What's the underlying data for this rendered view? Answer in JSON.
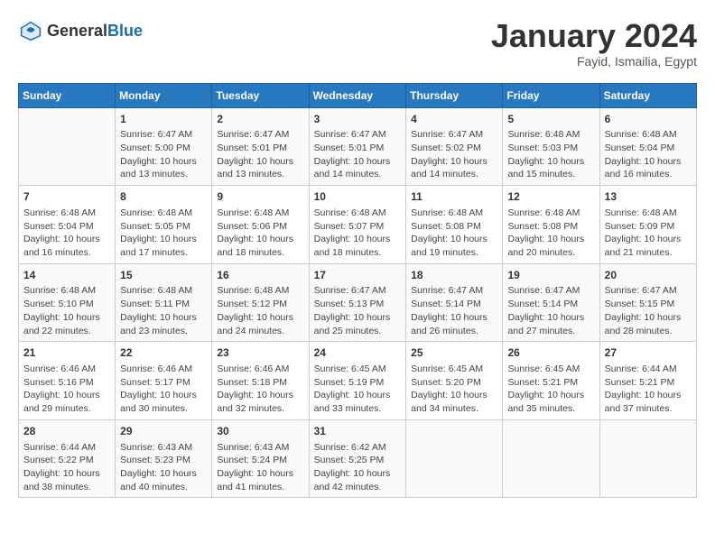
{
  "header": {
    "logo_general": "General",
    "logo_blue": "Blue",
    "month_title": "January 2024",
    "location": "Fayid, Ismailia, Egypt"
  },
  "columns": [
    "Sunday",
    "Monday",
    "Tuesday",
    "Wednesday",
    "Thursday",
    "Friday",
    "Saturday"
  ],
  "weeks": [
    [
      {
        "day": "",
        "content": ""
      },
      {
        "day": "1",
        "content": "Sunrise: 6:47 AM\nSunset: 5:00 PM\nDaylight: 10 hours\nand 13 minutes."
      },
      {
        "day": "2",
        "content": "Sunrise: 6:47 AM\nSunset: 5:01 PM\nDaylight: 10 hours\nand 13 minutes."
      },
      {
        "day": "3",
        "content": "Sunrise: 6:47 AM\nSunset: 5:01 PM\nDaylight: 10 hours\nand 14 minutes."
      },
      {
        "day": "4",
        "content": "Sunrise: 6:47 AM\nSunset: 5:02 PM\nDaylight: 10 hours\nand 14 minutes."
      },
      {
        "day": "5",
        "content": "Sunrise: 6:48 AM\nSunset: 5:03 PM\nDaylight: 10 hours\nand 15 minutes."
      },
      {
        "day": "6",
        "content": "Sunrise: 6:48 AM\nSunset: 5:04 PM\nDaylight: 10 hours\nand 16 minutes."
      }
    ],
    [
      {
        "day": "7",
        "content": "Sunrise: 6:48 AM\nSunset: 5:04 PM\nDaylight: 10 hours\nand 16 minutes."
      },
      {
        "day": "8",
        "content": "Sunrise: 6:48 AM\nSunset: 5:05 PM\nDaylight: 10 hours\nand 17 minutes."
      },
      {
        "day": "9",
        "content": "Sunrise: 6:48 AM\nSunset: 5:06 PM\nDaylight: 10 hours\nand 18 minutes."
      },
      {
        "day": "10",
        "content": "Sunrise: 6:48 AM\nSunset: 5:07 PM\nDaylight: 10 hours\nand 18 minutes."
      },
      {
        "day": "11",
        "content": "Sunrise: 6:48 AM\nSunset: 5:08 PM\nDaylight: 10 hours\nand 19 minutes."
      },
      {
        "day": "12",
        "content": "Sunrise: 6:48 AM\nSunset: 5:08 PM\nDaylight: 10 hours\nand 20 minutes."
      },
      {
        "day": "13",
        "content": "Sunrise: 6:48 AM\nSunset: 5:09 PM\nDaylight: 10 hours\nand 21 minutes."
      }
    ],
    [
      {
        "day": "14",
        "content": "Sunrise: 6:48 AM\nSunset: 5:10 PM\nDaylight: 10 hours\nand 22 minutes."
      },
      {
        "day": "15",
        "content": "Sunrise: 6:48 AM\nSunset: 5:11 PM\nDaylight: 10 hours\nand 23 minutes."
      },
      {
        "day": "16",
        "content": "Sunrise: 6:48 AM\nSunset: 5:12 PM\nDaylight: 10 hours\nand 24 minutes."
      },
      {
        "day": "17",
        "content": "Sunrise: 6:47 AM\nSunset: 5:13 PM\nDaylight: 10 hours\nand 25 minutes."
      },
      {
        "day": "18",
        "content": "Sunrise: 6:47 AM\nSunset: 5:14 PM\nDaylight: 10 hours\nand 26 minutes."
      },
      {
        "day": "19",
        "content": "Sunrise: 6:47 AM\nSunset: 5:14 PM\nDaylight: 10 hours\nand 27 minutes."
      },
      {
        "day": "20",
        "content": "Sunrise: 6:47 AM\nSunset: 5:15 PM\nDaylight: 10 hours\nand 28 minutes."
      }
    ],
    [
      {
        "day": "21",
        "content": "Sunrise: 6:46 AM\nSunset: 5:16 PM\nDaylight: 10 hours\nand 29 minutes."
      },
      {
        "day": "22",
        "content": "Sunrise: 6:46 AM\nSunset: 5:17 PM\nDaylight: 10 hours\nand 30 minutes."
      },
      {
        "day": "23",
        "content": "Sunrise: 6:46 AM\nSunset: 5:18 PM\nDaylight: 10 hours\nand 32 minutes."
      },
      {
        "day": "24",
        "content": "Sunrise: 6:45 AM\nSunset: 5:19 PM\nDaylight: 10 hours\nand 33 minutes."
      },
      {
        "day": "25",
        "content": "Sunrise: 6:45 AM\nSunset: 5:20 PM\nDaylight: 10 hours\nand 34 minutes."
      },
      {
        "day": "26",
        "content": "Sunrise: 6:45 AM\nSunset: 5:21 PM\nDaylight: 10 hours\nand 35 minutes."
      },
      {
        "day": "27",
        "content": "Sunrise: 6:44 AM\nSunset: 5:21 PM\nDaylight: 10 hours\nand 37 minutes."
      }
    ],
    [
      {
        "day": "28",
        "content": "Sunrise: 6:44 AM\nSunset: 5:22 PM\nDaylight: 10 hours\nand 38 minutes."
      },
      {
        "day": "29",
        "content": "Sunrise: 6:43 AM\nSunset: 5:23 PM\nDaylight: 10 hours\nand 40 minutes."
      },
      {
        "day": "30",
        "content": "Sunrise: 6:43 AM\nSunset: 5:24 PM\nDaylight: 10 hours\nand 41 minutes."
      },
      {
        "day": "31",
        "content": "Sunrise: 6:42 AM\nSunset: 5:25 PM\nDaylight: 10 hours\nand 42 minutes."
      },
      {
        "day": "",
        "content": ""
      },
      {
        "day": "",
        "content": ""
      },
      {
        "day": "",
        "content": ""
      }
    ]
  ]
}
